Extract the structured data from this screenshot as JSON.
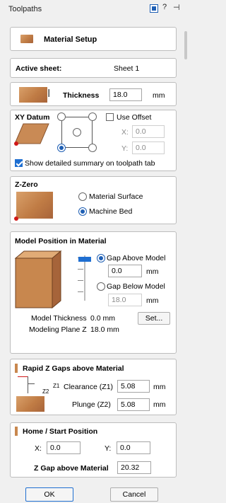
{
  "window": {
    "title": "Toolpaths"
  },
  "material_setup": {
    "label": "Material Setup"
  },
  "active_sheet": {
    "label": "Active sheet:",
    "value": "Sheet 1"
  },
  "thickness": {
    "label": "Thickness",
    "value": "18.0",
    "unit": "mm"
  },
  "xy_datum": {
    "title": "XY Datum",
    "use_offset_label": "Use Offset",
    "x_label": "X:",
    "x_value": "0.0",
    "y_label": "Y:",
    "y_value": "0.0",
    "summary_label": "Show detailed summary on toolpath tab"
  },
  "z_zero": {
    "title": "Z-Zero",
    "options": [
      "Material Surface",
      "Machine Bed"
    ],
    "selected": "Machine Bed"
  },
  "model_position": {
    "title": "Model Position in Material",
    "gap_above_label": "Gap Above Model",
    "gap_above_value": "0.0",
    "gap_below_label": "Gap Below Model",
    "gap_below_value": "18.0",
    "unit": "mm",
    "model_thickness_label": "Model Thickness",
    "model_thickness_value": "0.0 mm",
    "modeling_plane_label": "Modeling Plane Z",
    "modeling_plane_value": "18.0 mm",
    "set_button": "Set..."
  },
  "rapid_gaps": {
    "title": "Rapid Z Gaps above Material",
    "z1_tag": "Z1",
    "z2_tag": "Z2",
    "clearance_label": "Clearance (Z1)",
    "clearance_value": "5.08",
    "plunge_label": "Plunge (Z2)",
    "plunge_value": "5.08",
    "unit": "mm"
  },
  "home_position": {
    "title": "Home / Start Position",
    "x_label": "X:",
    "x_value": "0.0",
    "y_label": "Y:",
    "y_value": "0.0",
    "z_gap_label": "Z Gap above Material",
    "z_gap_value": "20.32"
  },
  "buttons": {
    "ok": "OK",
    "cancel": "Cancel"
  }
}
